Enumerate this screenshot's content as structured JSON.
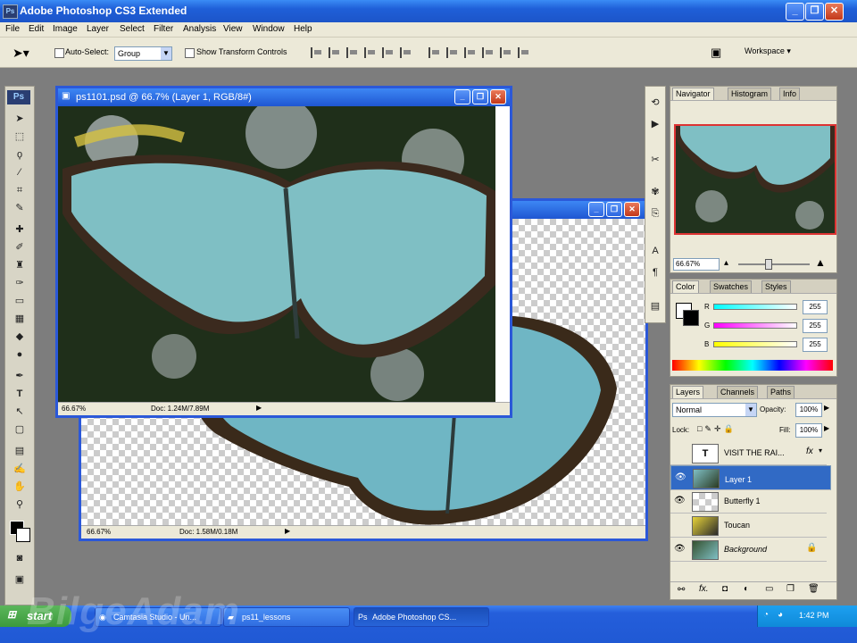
{
  "app": {
    "title": "Adobe Photoshop CS3 Extended",
    "logo": "Ps"
  },
  "menu": [
    "File",
    "Edit",
    "Image",
    "Layer",
    "Select",
    "Filter",
    "Analysis",
    "View",
    "Window",
    "Help"
  ],
  "options": {
    "auto_select_label": "Auto-Select:",
    "auto_select_value": "Group",
    "show_transform_label": "Show Transform Controls",
    "workspace_label": "Workspace ▾"
  },
  "doc_front": {
    "title": "ps1101.psd @ 66.7% (Layer 1, RGB/8#)",
    "zoom": "66.67%",
    "doc_size": "Doc: 1.24M/7.89M"
  },
  "doc_back": {
    "zoom": "66.67%",
    "doc_size": "Doc: 1.58M/0.18M"
  },
  "navigator": {
    "tabs": [
      "Navigator",
      "Histogram",
      "Info"
    ],
    "zoom": "66.67%"
  },
  "color": {
    "tabs": [
      "Color",
      "Swatches",
      "Styles"
    ],
    "r_label": "R",
    "g_label": "G",
    "b_label": "B",
    "r": "255",
    "g": "255",
    "b": "255"
  },
  "layers": {
    "tabs": [
      "Layers",
      "Channels",
      "Paths"
    ],
    "blend_mode": "Normal",
    "opacity_label": "Opacity:",
    "opacity": "100%",
    "lock_label": "Lock:",
    "fill_label": "Fill:",
    "fill": "100%",
    "items": [
      {
        "name": "VISIT THE RAI...",
        "type": "text",
        "visible": false,
        "fx": "fx"
      },
      {
        "name": "Layer 1",
        "type": "image",
        "visible": true,
        "selected": true
      },
      {
        "name": "Butterfly 1",
        "type": "image",
        "visible": true
      },
      {
        "name": "Toucan",
        "type": "image",
        "visible": false
      },
      {
        "name": "Background",
        "type": "image",
        "visible": true,
        "locked": true
      }
    ]
  },
  "taskbar": {
    "start": "start",
    "tasks": [
      "Camtasia Studio - Un...",
      "ps11_lessons",
      "Adobe Photoshop CS..."
    ],
    "clock": "1:42 PM"
  },
  "watermark": "BilgeAdam",
  "colors": {
    "titlebar": "#1f5fd8",
    "selection": "#316ac5",
    "panel": "#ece9d8",
    "butterfly": "#7fbfc4"
  }
}
